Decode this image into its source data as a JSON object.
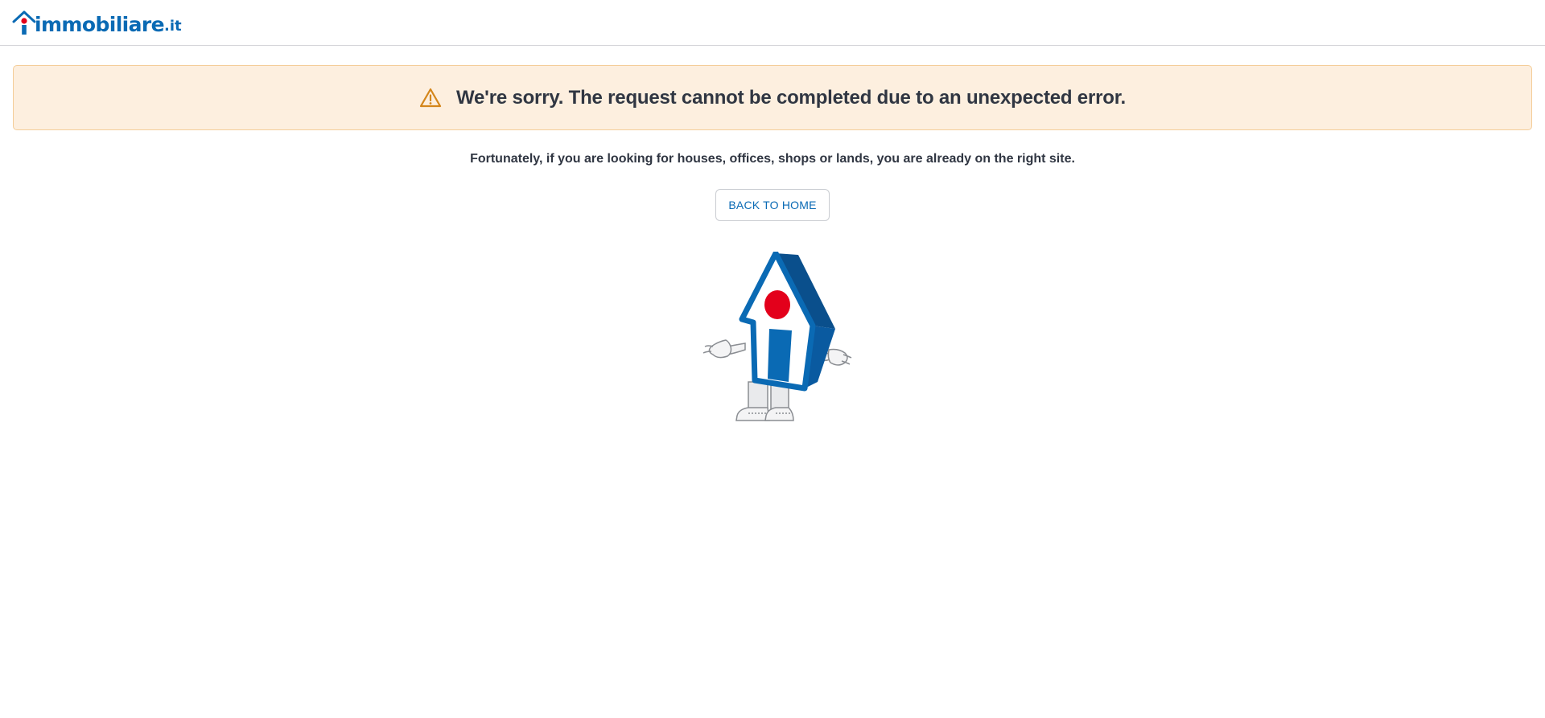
{
  "header": {
    "logo": {
      "name": "immobiliare",
      "tld": ".it",
      "house_icon": "house-i-icon"
    }
  },
  "alert": {
    "icon": "warning-triangle-icon",
    "message": "We're sorry. The request cannot be completed due to an unexpected error."
  },
  "main": {
    "subtitle": "Fortunately, if you are looking for houses, offices, shops or lands, you are already on the right site.",
    "back_home_label": "BACK TO HOME",
    "mascot": "house-mascot-shrug-illustration"
  },
  "colors": {
    "brand_blue": "#0a6ab4",
    "brand_red": "#e3001b",
    "alert_bg": "#fdefdf",
    "alert_border": "#f4cd98",
    "warning_icon": "#d4861b",
    "text": "#303642"
  }
}
